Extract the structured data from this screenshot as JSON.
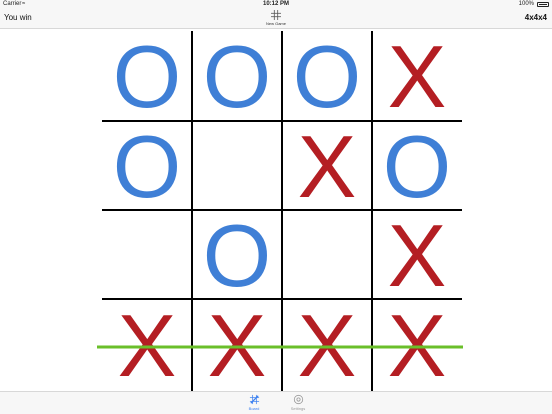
{
  "status_bar": {
    "carrier": "Carrier",
    "time": "10:12 PM",
    "battery": "100%"
  },
  "nav": {
    "status_text": "You win",
    "new_game_label": "New Game",
    "board_size": "4x4x4"
  },
  "board": {
    "size": 4,
    "cells": [
      [
        "O",
        "O",
        "O",
        "X"
      ],
      [
        "O",
        "",
        "X",
        "O"
      ],
      [
        "",
        "O",
        "",
        "X"
      ],
      [
        "X",
        "X",
        "X",
        "X"
      ]
    ],
    "winning_row": 3,
    "colors": {
      "o": "#3f7fd6",
      "x": "#b41e23",
      "win_line": "#6abf2a",
      "grid": "#000000"
    }
  },
  "tabs": [
    {
      "id": "board",
      "label": "Board",
      "icon": "pencil-board-icon",
      "selected": true
    },
    {
      "id": "settings",
      "label": "Settings",
      "icon": "gear-icon",
      "selected": false
    }
  ],
  "accent_color": "#3a7ff0"
}
